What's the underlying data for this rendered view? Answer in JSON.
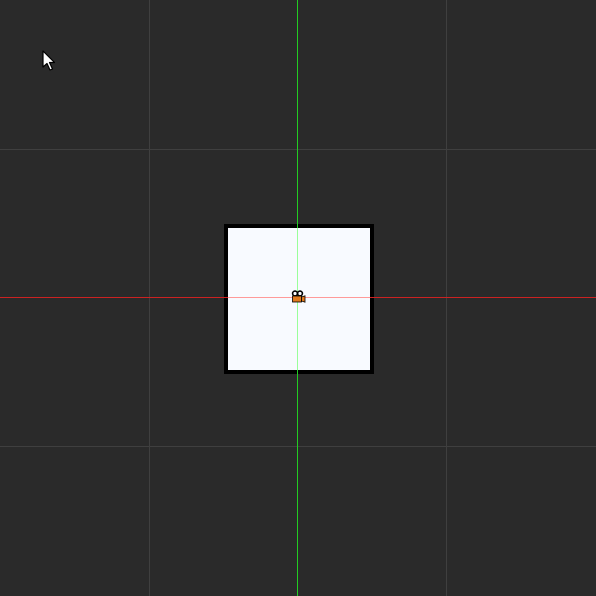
{
  "canvas": {
    "background_color": "#2a2a2a",
    "grid_color": "#3f3f3f",
    "show_grid": true
  },
  "sprite": {
    "fill_color": "#f8faff",
    "border_color": "#000000"
  },
  "axes": {
    "x_axis_color": "#cc2222",
    "y_axis_color": "#22cc22",
    "x_axis_inside_sprite_color": "#ff9a9a",
    "y_axis_inside_sprite_color": "#9aff9a"
  },
  "origin_gizmo": {
    "icon": "camera-icon",
    "accent_color": "#e07a1f"
  },
  "cursor": {
    "icon": "mouse-pointer-icon"
  }
}
